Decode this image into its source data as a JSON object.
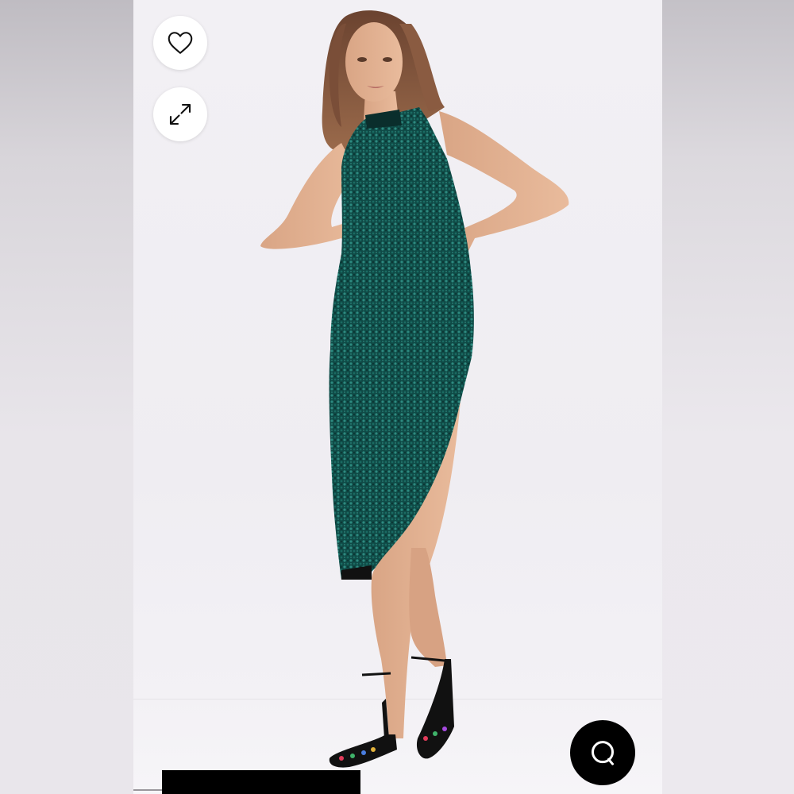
{
  "product_gallery": {
    "favorite_button_icon": "heart-outline-icon",
    "expand_button_icon": "expand-arrows-icon",
    "chat_button_icon": "chat-bubble-icon"
  },
  "colors": {
    "dress": "#0f4a46",
    "chat_button": "#000000",
    "button_background": "#ffffff"
  }
}
